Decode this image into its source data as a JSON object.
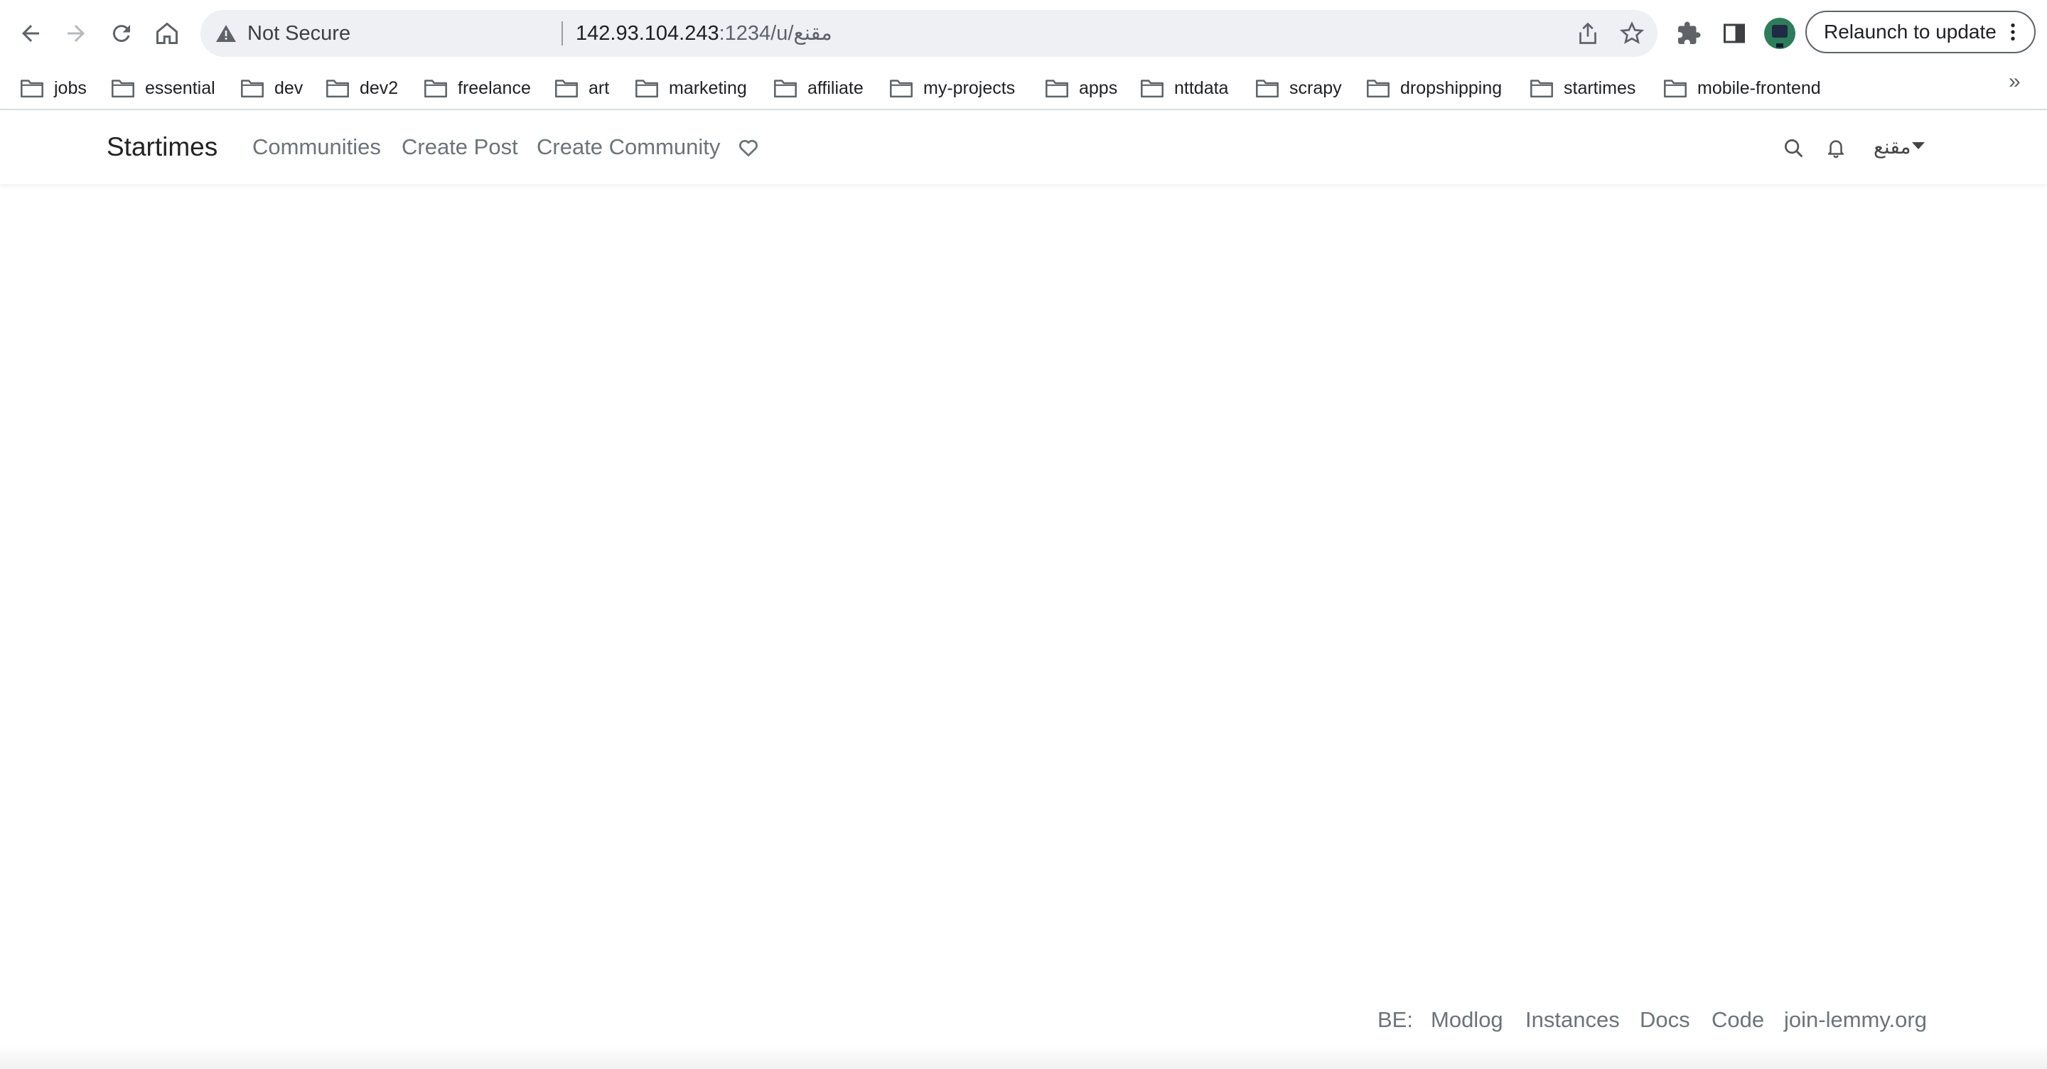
{
  "browser": {
    "omnibox": {
      "security_label": "Not Secure",
      "url_host": "142.93.104.243",
      "url_rest": ":1234/u/مقنع"
    },
    "relaunch_label": "Relaunch to update",
    "bookmarks": [
      "jobs",
      "essential",
      "dev",
      "dev2",
      "freelance",
      "art",
      "marketing",
      "affiliate",
      "my-projects",
      "apps",
      "nttdata",
      "scrapy",
      "dropshipping",
      "startimes",
      "mobile-frontend"
    ],
    "bookmarks_overflow": "»"
  },
  "site": {
    "brand": "Startimes",
    "nav": {
      "communities": "Communities",
      "create_post": "Create Post",
      "create_community": "Create Community"
    },
    "user_name": "مقنع"
  },
  "footer": {
    "be": "BE:",
    "modlog": "Modlog",
    "instances": "Instances",
    "docs": "Docs",
    "code": "Code",
    "join": "join-lemmy.org"
  },
  "colors": {
    "nav_link": "#6c7379",
    "omnibox_bg": "#eef0f3"
  }
}
